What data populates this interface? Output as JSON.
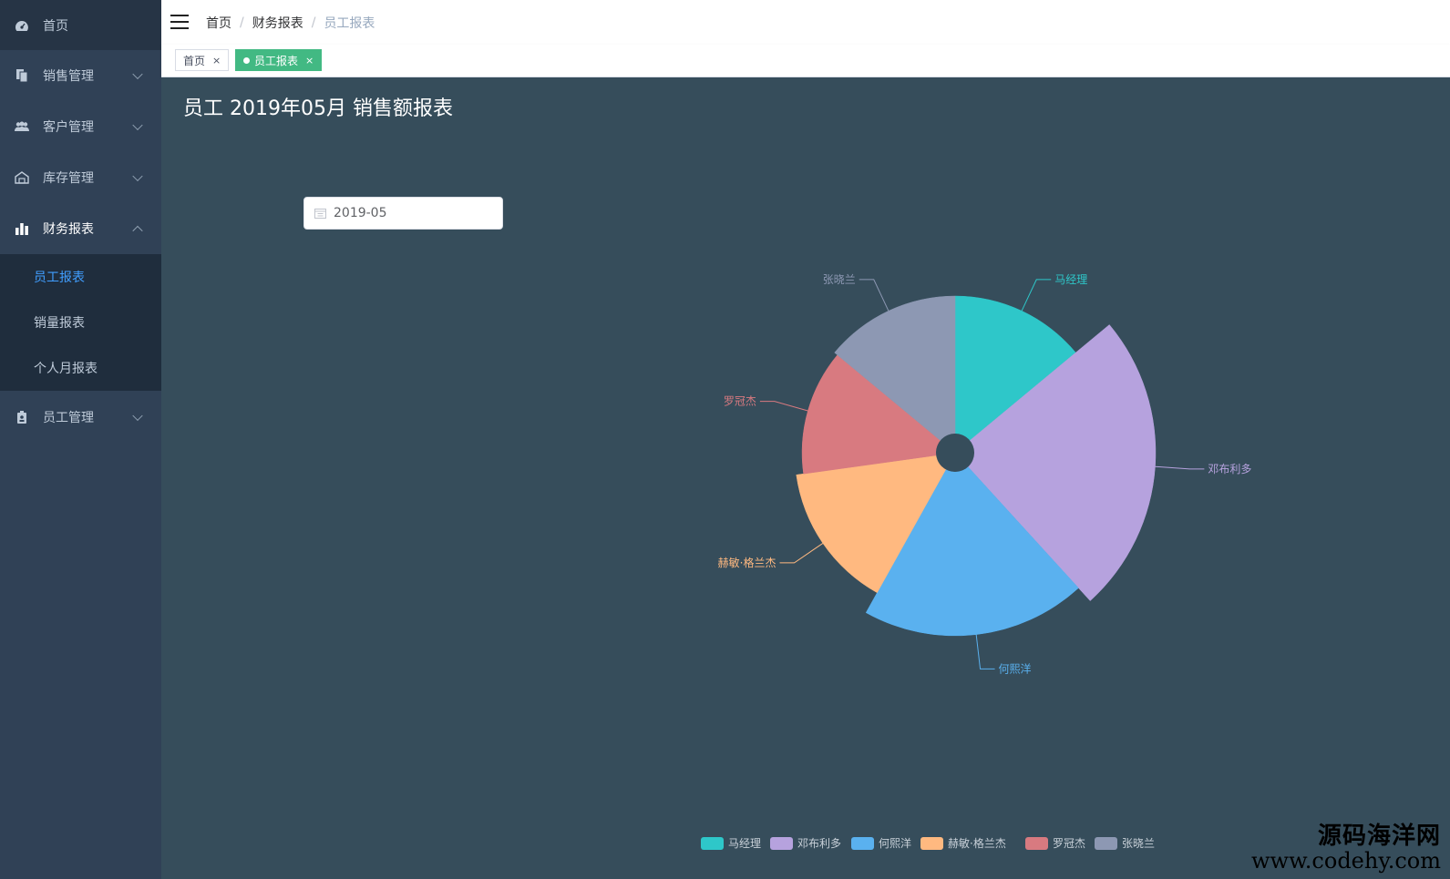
{
  "sidebar": {
    "items": [
      {
        "label": "首页",
        "icon": "dashboard-icon"
      },
      {
        "label": "销售管理",
        "icon": "document-icon"
      },
      {
        "label": "客户管理",
        "icon": "users-icon"
      },
      {
        "label": "库存管理",
        "icon": "warehouse-icon"
      },
      {
        "label": "财务报表",
        "icon": "bar-chart-icon"
      },
      {
        "label": "员工管理",
        "icon": "badge-icon"
      }
    ],
    "finance_submenu": [
      "员工报表",
      "销量报表",
      "个人月报表"
    ],
    "active_sub": "员工报表"
  },
  "breadcrumb": [
    "首页",
    "财务报表",
    "员工报表"
  ],
  "tags": [
    {
      "label": "首页",
      "close": "×"
    },
    {
      "label": "员工报表",
      "close": "×"
    }
  ],
  "page": {
    "title": "员工 2019年05月 销售额报表",
    "date_value": "2019-05"
  },
  "chart_data": {
    "type": "pie",
    "variant": "rose-radius",
    "categories": [
      "马经理",
      "邓布利多",
      "何熙洋",
      "赫敏·格兰杰",
      "罗冠杰",
      "张晓兰"
    ],
    "values": [
      9.5,
      16.5,
      13.5,
      10,
      9,
      9.5
    ],
    "colors": [
      "#2ec7c9",
      "#b6a2de",
      "#5ab1ef",
      "#ffb980",
      "#d87a80",
      "#8d98b3"
    ],
    "legend_position": "bottom"
  },
  "watermark": {
    "line1": "源码海洋网",
    "line2": "www.codehy.com"
  }
}
